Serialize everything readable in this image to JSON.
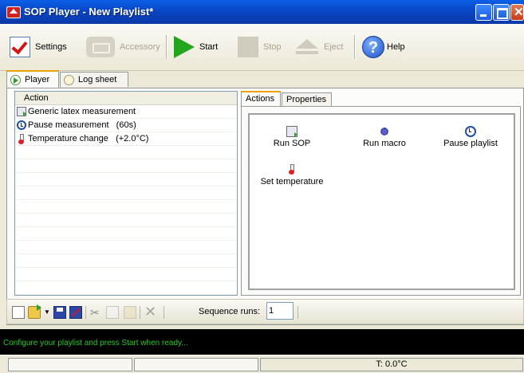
{
  "window": {
    "title": "SOP Player - New Playlist*"
  },
  "toolbar": {
    "settings": "Settings",
    "accessory": "Accessory",
    "start": "Start",
    "stop": "Stop",
    "eject": "Eject",
    "help": "Help"
  },
  "main_tabs": [
    {
      "label": "Player",
      "active": true
    },
    {
      "label": "Log sheet",
      "active": false
    }
  ],
  "playlist": {
    "header": "Action",
    "rows": [
      {
        "icon": "sop-icon",
        "label": "Generic latex measurement"
      },
      {
        "icon": "clock-icon",
        "label": "Pause measurement   (60s)"
      },
      {
        "icon": "thermometer-icon",
        "label": "Temperature change   (+2.0°C)"
      }
    ]
  },
  "right_tabs": [
    {
      "label": "Actions",
      "active": true
    },
    {
      "label": "Properties",
      "active": false
    }
  ],
  "actions": [
    {
      "icon": "sop-icon",
      "label": "Run SOP"
    },
    {
      "icon": "macro-icon",
      "label": "Run macro"
    },
    {
      "icon": "clock-icon",
      "label": "Pause playlist"
    },
    {
      "icon": "thermometer-icon",
      "label": "Set temperature"
    }
  ],
  "sequence": {
    "label": "Sequence runs:",
    "value": "1"
  },
  "status": {
    "message": "Configure your playlist and press Start when ready...",
    "temperature": "T: 0.0°C"
  },
  "colors": {
    "titlebar": "#0a4fd6",
    "status_text": "#22cc22",
    "start_green": "#22a61c"
  }
}
